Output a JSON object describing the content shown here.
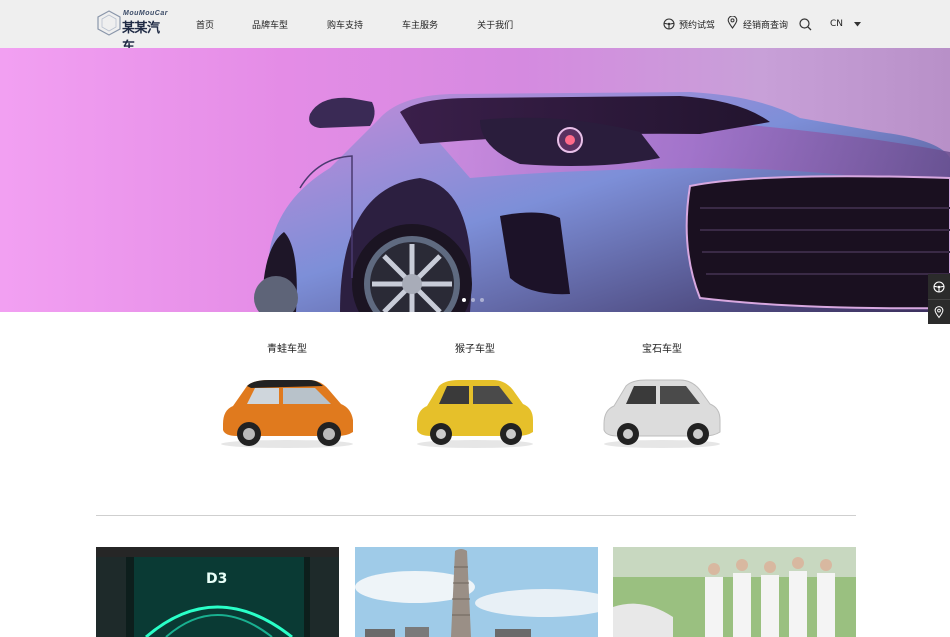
{
  "brand": {
    "name_cn": "某某汽车",
    "name_en": "MouMouCar"
  },
  "nav": [
    {
      "label": "首页"
    },
    {
      "label": "品牌车型"
    },
    {
      "label": "购车支持"
    },
    {
      "label": "车主服务"
    },
    {
      "label": "关于我们"
    }
  ],
  "header_actions": {
    "test_drive": "预约试驾",
    "dealer": "经销商查询",
    "lang": "CN"
  },
  "hero": {
    "slide_count": 3,
    "active_slide": 1
  },
  "models": [
    {
      "name": "青蛙车型",
      "color": "#e07a1e"
    },
    {
      "name": "猴子车型",
      "color": "#e6c02a"
    },
    {
      "name": "宝石车型",
      "color": "#d8d8d8"
    }
  ],
  "icons": [
    "steering-wheel-icon",
    "map-pin-icon",
    "search-icon",
    "caret-down-icon"
  ],
  "colors": {
    "header_bg": "#efefef",
    "hero_bg": "#e48ce6",
    "floatbar_bg": "#2b2b2b"
  }
}
